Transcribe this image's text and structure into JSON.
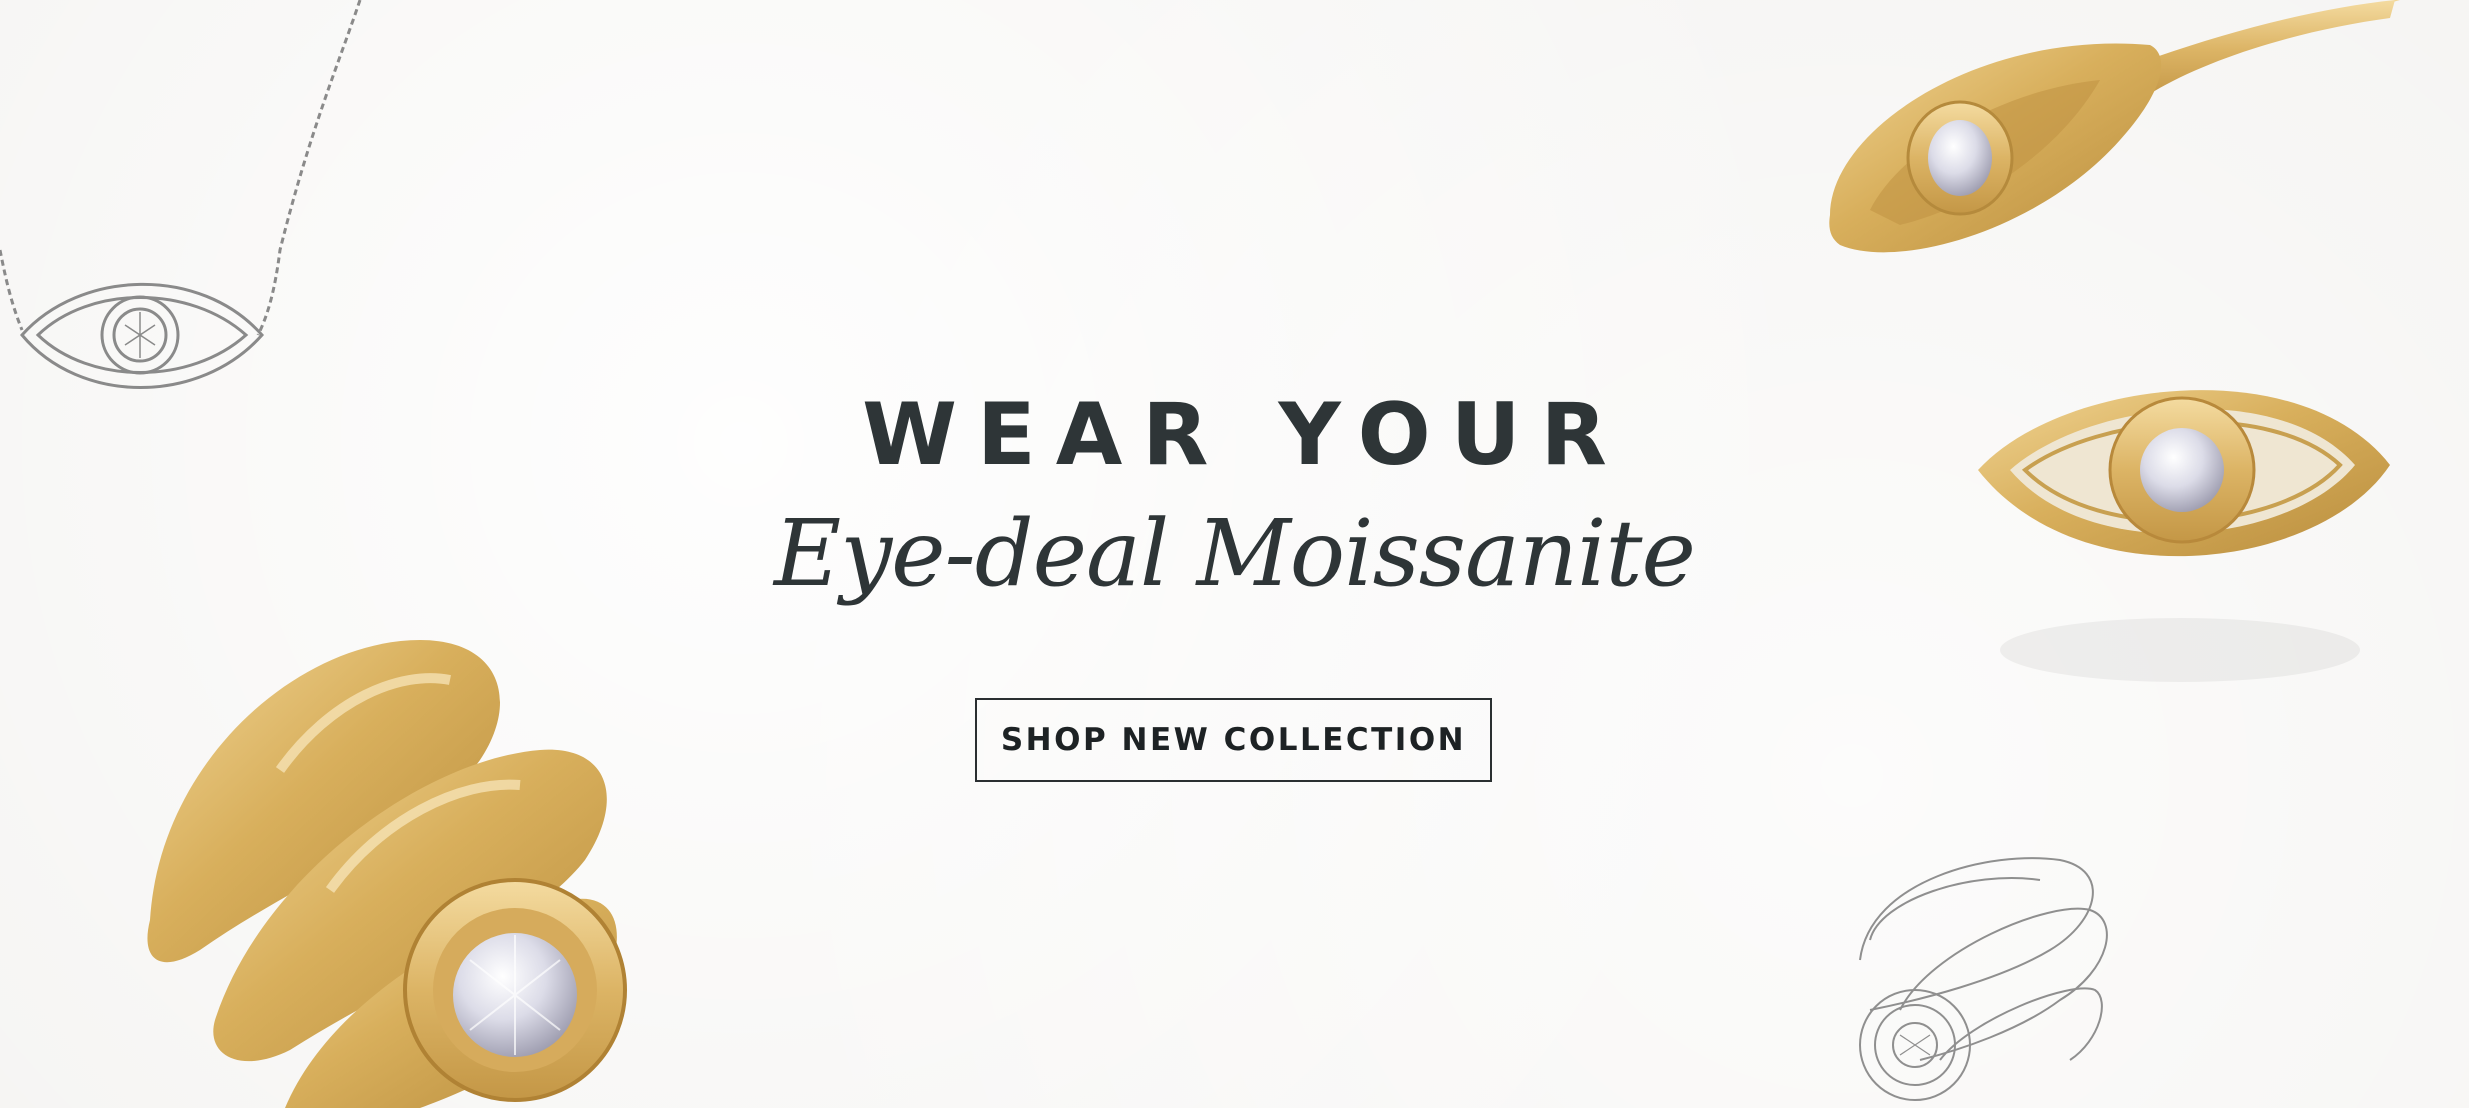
{
  "hero": {
    "headline": "WEAR YOUR",
    "subheadline": "Eye-deal Moissanite",
    "cta_label": "SHOP NEW COLLECTION"
  },
  "colors": {
    "text": "#2e3537",
    "gold": "#d9b260",
    "background": "#f5f4f2"
  },
  "images": [
    {
      "name": "evil-eye-necklace-sketch"
    },
    {
      "name": "gold-evil-eye-stud-earring"
    },
    {
      "name": "gold-evil-eye-earring-on-post"
    },
    {
      "name": "gold-spiral-moissanite-ring"
    },
    {
      "name": "spiral-ring-sketch"
    }
  ]
}
